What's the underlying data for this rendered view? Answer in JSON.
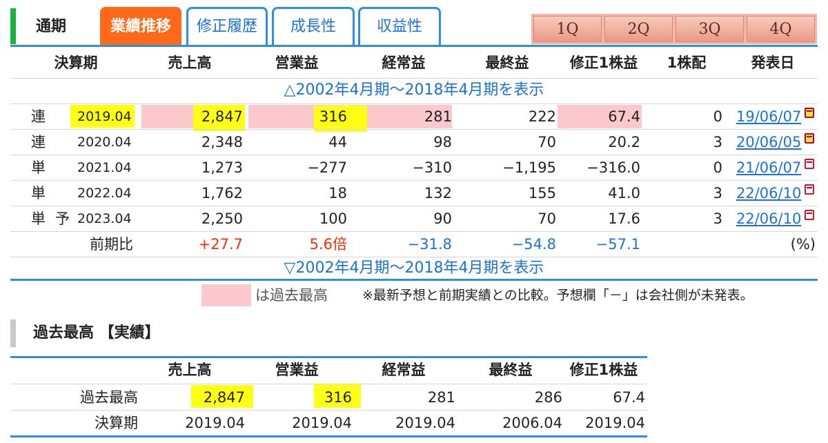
{
  "tabs": {
    "period": "通期",
    "items": [
      {
        "label": "業績推移",
        "active": true
      },
      {
        "label": "修正履歴",
        "active": false
      },
      {
        "label": "成長性",
        "active": false
      },
      {
        "label": "収益性",
        "active": false
      }
    ],
    "quarters": [
      "1Q",
      "2Q",
      "3Q",
      "4Q"
    ]
  },
  "main_table": {
    "headers": [
      "決算期",
      "売上高",
      "営業益",
      "経常益",
      "最終益",
      "修正1株益",
      "1株配",
      "発表日"
    ],
    "toggle_open": "△2002年4月期～2018年4月期を表示",
    "toggle_close": "▽2002年4月期～2018年4月期を表示",
    "rows": [
      {
        "type": "連",
        "forecast": "",
        "period": "2019.04",
        "sales": "2,847",
        "op": "316",
        "ord": "281",
        "net": "222",
        "eps": "67.4",
        "div": "0",
        "date": "19/06/07",
        "icon": "yellow-calendar-icon"
      },
      {
        "type": "連",
        "forecast": "",
        "period": "2020.04",
        "sales": "2,348",
        "op": "44",
        "ord": "98",
        "net": "70",
        "eps": "20.2",
        "div": "3",
        "date": "20/06/05",
        "icon": "yellow-calendar-icon"
      },
      {
        "type": "単",
        "forecast": "",
        "period": "2021.04",
        "sales": "1,273",
        "op": "−277",
        "ord": "−310",
        "net": "−1,195",
        "eps": "−316.0",
        "div": "0",
        "date": "21/06/07",
        "icon": "pdf-calendar-icon"
      },
      {
        "type": "単",
        "forecast": "",
        "period": "2022.04",
        "sales": "1,762",
        "op": "18",
        "ord": "132",
        "net": "155",
        "eps": "41.0",
        "div": "3",
        "date": "22/06/10",
        "icon": "pdf-calendar-icon"
      },
      {
        "type": "単",
        "forecast": "予",
        "period": "2023.04",
        "sales": "2,250",
        "op": "100",
        "ord": "90",
        "net": "70",
        "eps": "17.6",
        "div": "3",
        "date": "22/06/10",
        "icon": "pdf-calendar-icon"
      }
    ],
    "ratio": {
      "label": "前期比",
      "sales": "+27.7",
      "op": "5.6倍",
      "ord": "−31.8",
      "net": "−54.8",
      "eps": "−57.1",
      "unit": "(%)"
    }
  },
  "legend": {
    "swatch_text": "は過去最高",
    "note": "※最新予想と前期実績との比較。予想欄「－」は会社側が未発表。"
  },
  "record": {
    "title": "過去最高 【実績】",
    "headers": [
      "売上高",
      "営業益",
      "経常益",
      "最終益",
      "修正1株益"
    ],
    "high_label": "過去最高",
    "high": [
      "2,847",
      "316",
      "281",
      "286",
      "67.4"
    ],
    "period_label": "決算期",
    "periods": [
      "2019.04",
      "2019.04",
      "2019.04",
      "2006.04",
      "2019.04"
    ]
  },
  "colors": {
    "accent_blue": "#2d8ee8",
    "active_tab": "#ff6a1a",
    "record_high": "#fbc9cb",
    "highlight": "#ffff14",
    "positive": "#ff2a00",
    "negative": "#1a72d8"
  }
}
